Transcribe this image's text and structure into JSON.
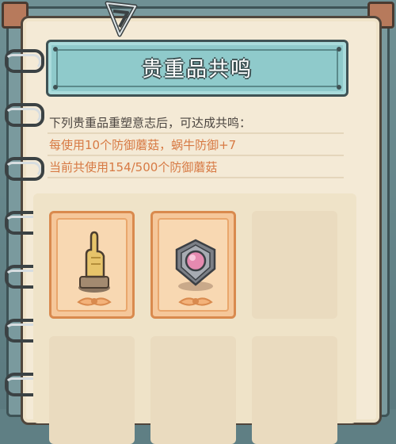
{
  "header": {
    "title": "贵重品共鸣"
  },
  "description": {
    "intro": "下列贵重品重塑意志后，可达成共鸣：",
    "bonus": "每使用10个防御蘑菇，蜗牛防御+7",
    "progress": "当前共使用154/500个防御蘑菇"
  },
  "slots": [
    {
      "state": "filled",
      "icon": "golden-hand-statue-icon"
    },
    {
      "state": "filled",
      "icon": "gem-shield-icon"
    },
    {
      "state": "empty"
    },
    {
      "state": "empty"
    },
    {
      "state": "empty"
    },
    {
      "state": "empty"
    }
  ],
  "colors": {
    "paper": "#f4ead6",
    "banner": "#8fcacb",
    "highlight_text": "#d77a44",
    "slot_filled": "#f5c79a"
  }
}
